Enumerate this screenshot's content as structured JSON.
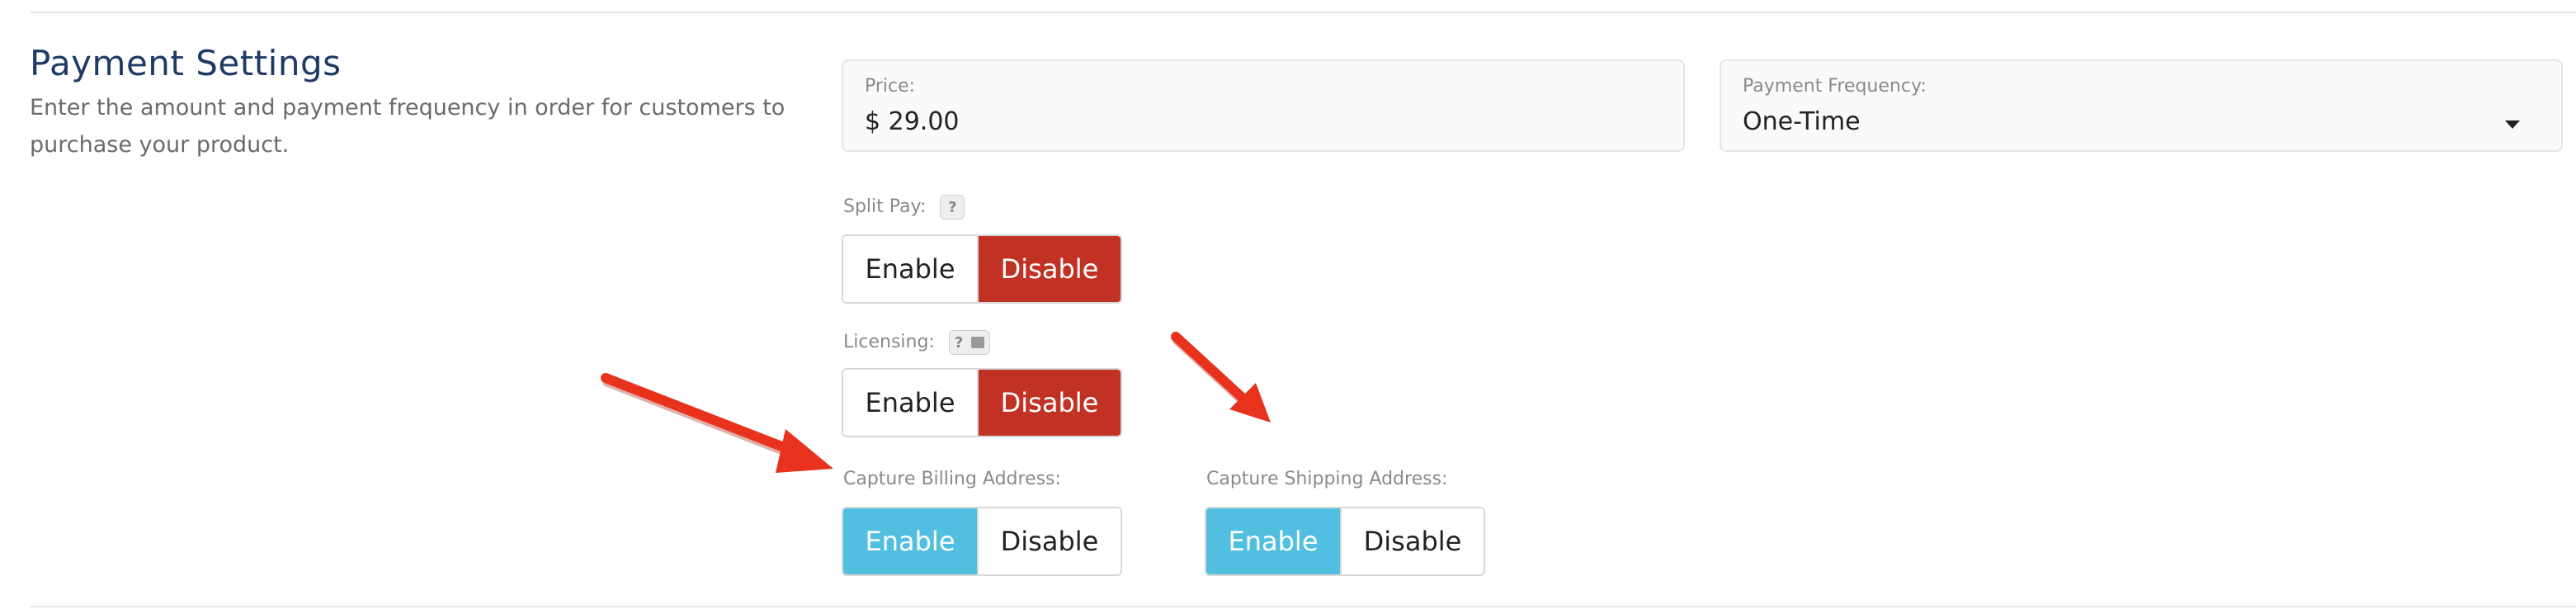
{
  "section": {
    "title": "Payment Settings",
    "description": "Enter the amount and payment frequency in order for customers to purchase your product."
  },
  "price": {
    "label": "Price:",
    "value": "$ 29.00"
  },
  "frequency": {
    "label": "Payment Frequency:",
    "value": "One-Time"
  },
  "split_pay": {
    "label": "Split Pay:",
    "help": "?",
    "enable": "Enable",
    "disable": "Disable",
    "selected": "Disable"
  },
  "licensing": {
    "label": "Licensing:",
    "help": "?",
    "enable": "Enable",
    "disable": "Disable",
    "selected": "Disable"
  },
  "billing": {
    "label": "Capture Billing Address:",
    "enable": "Enable",
    "disable": "Disable",
    "selected": "Enable"
  },
  "shipping": {
    "label": "Capture Shipping Address:",
    "enable": "Enable",
    "disable": "Disable",
    "selected": "Enable"
  },
  "colors": {
    "selected_disable": "#c13224",
    "selected_enable": "#53bfe0",
    "annotation_arrow": "#e8321e",
    "title": "#1f3a64"
  }
}
